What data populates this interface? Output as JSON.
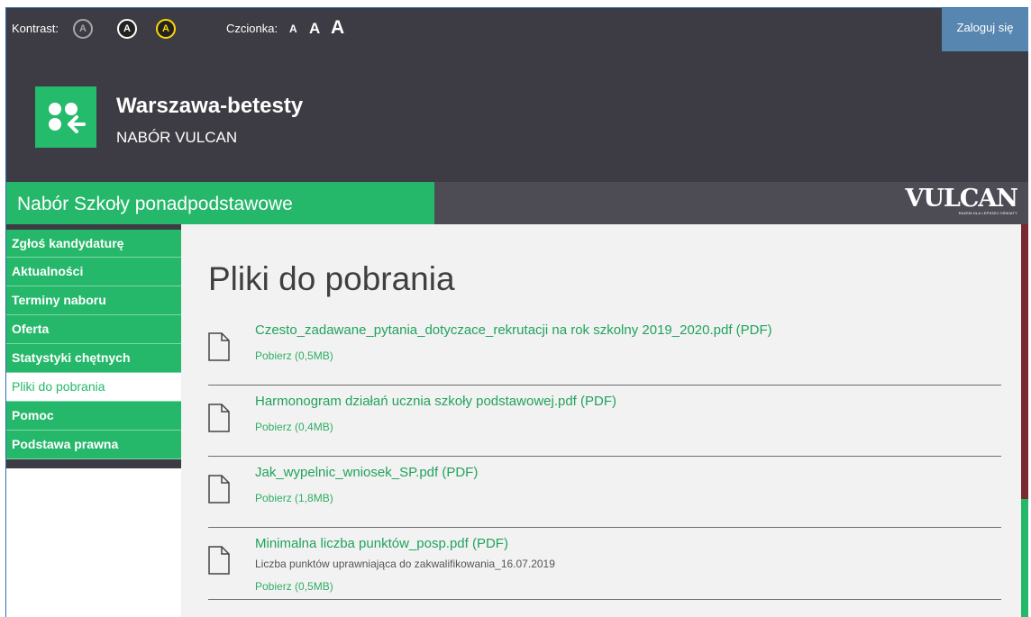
{
  "topbar": {
    "contrast_label": "Kontrast:",
    "contrast_buttons": [
      "A",
      "A",
      "A"
    ],
    "font_label": "Czcionka:",
    "font_buttons": [
      "A",
      "A",
      "A"
    ],
    "login_label": "Zaloguj się"
  },
  "brand": {
    "title": "Warszawa-betesty",
    "subtitle": "NABÓR VULCAN"
  },
  "section": {
    "title": "Nabór Szkoły ponadpodstawowe",
    "vendor_logo": "VULCAN",
    "vendor_tagline": "RAZEM DLA LEPSZEJ OŚWIATY"
  },
  "nav": {
    "items": [
      {
        "label": "Zgłoś kandydaturę"
      },
      {
        "label": "Aktualności"
      },
      {
        "label": "Terminy naboru"
      },
      {
        "label": "Oferta"
      },
      {
        "label": "Statystyki chętnych"
      },
      {
        "label": "Pliki do pobrania",
        "active": true
      },
      {
        "label": "Pomoc"
      },
      {
        "label": "Podstawa prawna"
      }
    ]
  },
  "main": {
    "title": "Pliki do pobrania",
    "files": [
      {
        "name": "Czesto_zadawane_pytania_dotyczace_rekrutacji na rok szkolny 2019_2020.pdf (PDF)",
        "download": "Pobierz (0,5MB)"
      },
      {
        "name": "Harmonogram działań ucznia szkoły podstawowej.pdf (PDF)",
        "download": "Pobierz (0,4MB)"
      },
      {
        "name": "Jak_wypelnic_wniosek_SP.pdf (PDF)",
        "download": "Pobierz (1,8MB)"
      },
      {
        "name": "Minimalna liczba punktów_posp.pdf (PDF)",
        "description": "Liczba punktów uprawniająca do zakwalifikowania_16.07.2019",
        "download": "Pobierz (0,5MB)"
      }
    ]
  },
  "colors": {
    "accent_green": "#26b86a",
    "header_dark": "#3d3c44",
    "login_blue": "#5786b0",
    "contrast_yellow": "#ffd800"
  },
  "icons": [
    "app-logo-icon",
    "document-icon"
  ]
}
